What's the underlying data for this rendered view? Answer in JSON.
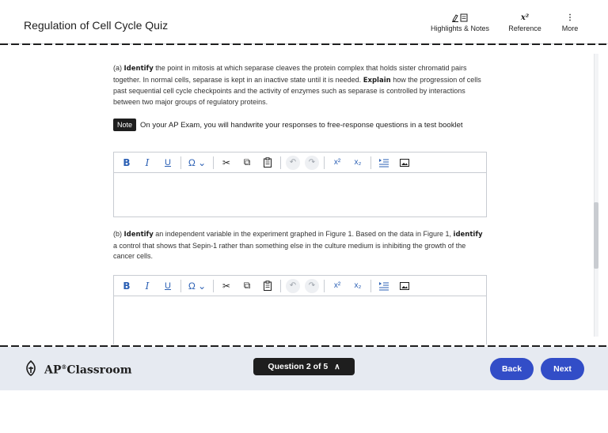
{
  "header": {
    "title": "Regulation of Cell Cycle Quiz",
    "highlights_label": "Highlights & Notes",
    "reference_label": "Reference",
    "more_label": "More",
    "reference_icon": "x²",
    "more_icon": "⋮"
  },
  "question_a": {
    "prefix": "(a) ",
    "identify": "Identify",
    "text1": " the point in mitosis at which separase cleaves the protein complex that holds sister chromatid pairs together. In normal cells, separase is kept in an inactive state until it is needed. ",
    "explain": "Explain",
    "text2": " how the progression of cells past sequential cell cycle checkpoints and the activity of enzymes such as separase is controlled by interactions between two major groups of regulatory proteins."
  },
  "note": {
    "badge": "Note",
    "text": "On your AP Exam, you will handwrite your responses to free-response questions in a test booklet"
  },
  "question_b": {
    "prefix": "(b) ",
    "identify1": "Identify",
    "text1": " an independent variable in the experiment graphed in Figure 1. Based on the data in Figure 1, ",
    "identify2": "identify",
    "text2": " a control that shows that Sepin-1 rather than something else in the culture medium is inhibiting the growth of the cancer cells."
  },
  "toolbar": {
    "bold": "B",
    "italic": "I",
    "underline": "U",
    "special_char": "Ω ⌄",
    "cut": "✂",
    "copy": "⧉",
    "paste": "📋",
    "undo": "↶",
    "redo": "↷",
    "superscript": "x²",
    "subscript": "x₂",
    "indent": "⇥≡",
    "image": "▭"
  },
  "footer": {
    "brand": "AP",
    "brand_sup": "®",
    "brand_rest": "Classroom",
    "question_nav": "Question 2 of 5",
    "question_nav_icon": "∧",
    "back": "Back",
    "next": "Next"
  },
  "colors": {
    "accent": "#324dc7",
    "toolbar_icon": "#2a5fb4",
    "footer_bg": "#e6eaf1"
  }
}
